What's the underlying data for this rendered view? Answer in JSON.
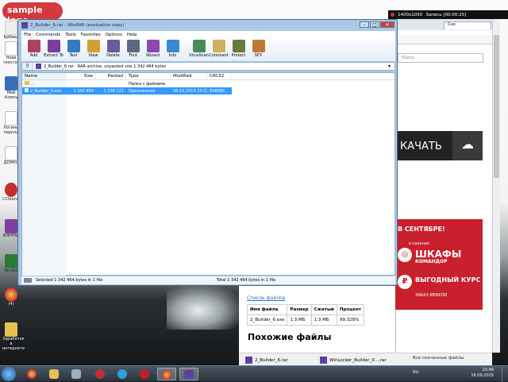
{
  "desktop": {
    "logo": "sample logo",
    "icons": [
      {
        "label": "Брбвер",
        "color": "#f2f2f2"
      },
      {
        "label": "Нови текстов",
        "color": "#f5f5f5"
      },
      {
        "label": "Мой Компь",
        "color": "#3870b8"
      },
      {
        "label": "Логины пароли",
        "color": "#fafafa"
      },
      {
        "label": "ДОМУС",
        "color": "#f0f0f0"
      },
      {
        "label": "CCleaner",
        "color": "#c03030"
      },
      {
        "label": "ВИНРАР",
        "color": "#8040a0"
      },
      {
        "label": "Yandex",
        "color": "#2a7a3a"
      },
      {
        "label": "(4)",
        "color": "#e8a020"
      },
      {
        "label": "Заработок в интернете",
        "color": "#e8c050"
      }
    ]
  },
  "recorder": {
    "resolution": "1400x1050",
    "status": "Запись [00:00:25]"
  },
  "browser": {
    "search_placeholder": "Поиск",
    "tab_label": "Сно",
    "download_button": "КАЧАТЬ",
    "ad": {
      "headline": "В СЕНТЯБРЕ!",
      "line1": "в салонах",
      "brand": "ШКАФЫ",
      "brand_sub": "КОМАНДОР",
      "offer": "ВЫГОДНЫЙ КУРС",
      "footer": "ЗАКАЗ МЕБЕЛИ"
    },
    "files_link": "Список файлов",
    "files_table": {
      "headers": [
        "Имя файла",
        "Размер",
        "Сжатый",
        "Процент"
      ],
      "rows": [
        [
          "2_Builder_6.exe",
          "1.3 МБ",
          "1.3 МБ",
          "99.328%"
        ]
      ]
    },
    "similar_heading": "Похожие файлы",
    "downloads": [
      {
        "name": "2_Builder_6.rar"
      },
      {
        "name": "WinLocker_Builder_0....rar"
      }
    ],
    "show_all": "Все скачанные файлы"
  },
  "winrar": {
    "title": "2_Builder_6.rar - WinRAR (evaluation copy)",
    "menu": [
      "File",
      "Commands",
      "Tools",
      "Favorites",
      "Options",
      "Help"
    ],
    "toolbar": [
      {
        "label": "Add",
        "color": "#b04060"
      },
      {
        "label": "Extract To",
        "color": "#7a3f9a"
      },
      {
        "label": "Test",
        "color": "#3a78c0"
      },
      {
        "label": "View",
        "color": "#d0a030"
      },
      {
        "label": "Delete",
        "color": "#6a5aa0"
      },
      {
        "label": "Find",
        "color": "#5a6a80"
      },
      {
        "label": "Wizard",
        "color": "#8a4ab0"
      },
      {
        "label": "Info",
        "color": "#3a8ad0"
      },
      {
        "label": "VirusScan",
        "color": "#4a8a5a"
      },
      {
        "label": "Comment",
        "color": "#d0b060"
      },
      {
        "label": "Protect",
        "color": "#6a7a3a"
      },
      {
        "label": "SFX",
        "color": "#c07a30"
      }
    ],
    "path": "2_Builder_6.rar - RAR archive, unpacked size 1 342 464 bytes",
    "columns": [
      "Name",
      "Size",
      "Packed",
      "Type",
      "Modified",
      "CRC32"
    ],
    "rows": [
      {
        "name": "..",
        "size": "",
        "packed": "",
        "type": "Папка с файлами",
        "modified": "",
        "crc": "",
        "selected": false
      },
      {
        "name": "2_Builder_6.exe",
        "size": "1 342 464",
        "packed": "1 336 121",
        "type": "Приложение",
        "modified": "08.10.2014 23:02",
        "crc": "EA6080...",
        "selected": true
      }
    ],
    "status_left": "Selected 1 342 464 bytes in 1 file",
    "status_right": "Total 1 342 464 bytes in 1 file"
  },
  "taskbar": {
    "lang": "RU",
    "time": "23:46",
    "date": "16.09.2015"
  }
}
